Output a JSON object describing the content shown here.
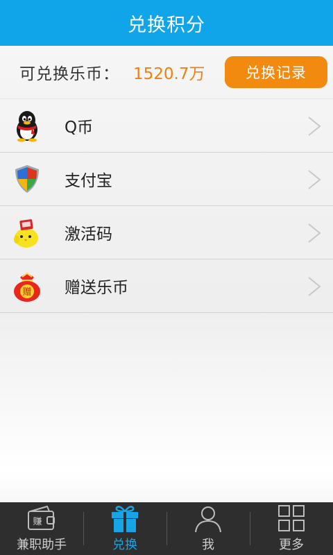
{
  "header": {
    "title": "兑换积分"
  },
  "balance": {
    "label": "可兑换乐币：",
    "value": "1520.7万",
    "record_button": "兑换记录"
  },
  "list": [
    {
      "label": "Q币",
      "icon": "qq-penguin-icon"
    },
    {
      "label": "支付宝",
      "icon": "alipay-shield-icon"
    },
    {
      "label": "激活码",
      "icon": "chick-gift-icon"
    },
    {
      "label": "赠送乐币",
      "icon": "gift-bag-icon"
    }
  ],
  "tabs": [
    {
      "label": "兼职助手",
      "icon": "wallet-earn-icon",
      "active": false
    },
    {
      "label": "兑换",
      "icon": "gift-icon",
      "active": true
    },
    {
      "label": "我",
      "icon": "user-icon",
      "active": false
    },
    {
      "label": "更多",
      "icon": "grid-icon",
      "active": false
    }
  ],
  "colors": {
    "header": "#10a4e8",
    "accent": "#f28a0f",
    "value": "#f07f12",
    "tab_active": "#17a5e6"
  },
  "icon_text": {
    "bag_char": "赠",
    "wallet_char": "赚"
  }
}
